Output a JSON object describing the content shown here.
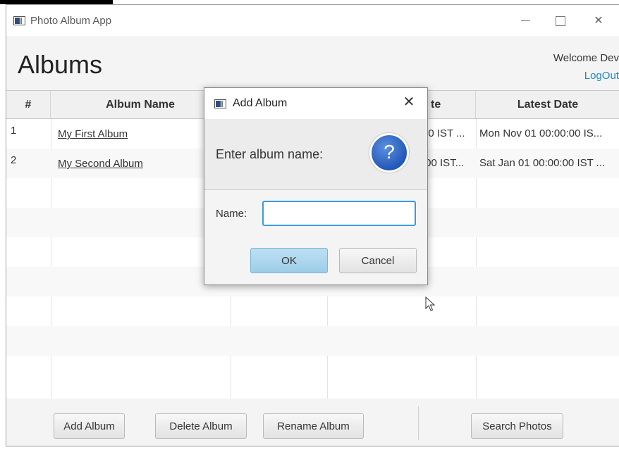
{
  "window": {
    "title": "Photo Album App",
    "controls": {
      "minimize": "minimize-icon",
      "maximize": "maximize-icon",
      "close": "✕"
    }
  },
  "header": {
    "heading": "Albums",
    "welcome": "Welcome Dev",
    "logout": "LogOut"
  },
  "table": {
    "columns": [
      "#",
      "Album Name",
      "",
      "te",
      "Latest Date"
    ],
    "rows": [
      {
        "num": "1",
        "name": "My First Album",
        "earliest": "00 IST ...",
        "latest": "Mon Nov 01 00:00:00 IS..."
      },
      {
        "num": "2",
        "name": "My Second Album",
        "earliest": ":00 IST...",
        "latest": "Sat Jan 01 00:00:00 IST ..."
      }
    ]
  },
  "footer": {
    "add": "Add Album",
    "delete": "Delete Album",
    "rename": "Rename Album",
    "search": "Search Photos"
  },
  "dialog": {
    "title": "Add Album",
    "close": "✕",
    "message": "Enter album name:",
    "icon_glyph": "?",
    "name_label": "Name:",
    "name_value": "",
    "ok": "OK",
    "cancel": "Cancel"
  },
  "colors": {
    "accent": "#3a9be0",
    "link": "#1e88c8",
    "ok_button": "#9ccde8"
  }
}
